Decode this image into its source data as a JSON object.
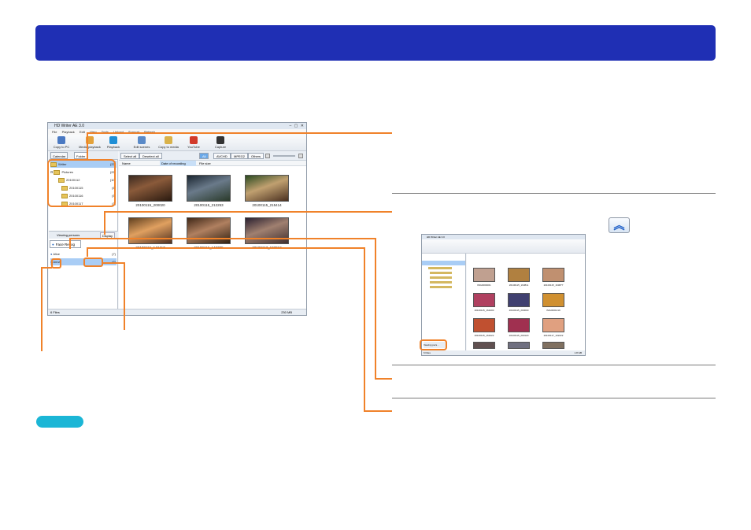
{
  "window": {
    "title": "HD Writer AE 3.0",
    "controls": "– ▢ ✕",
    "menu": [
      "File",
      "Playback",
      "Edit",
      "View",
      "Tools",
      "Upload",
      "Support",
      "Refresh"
    ],
    "toolbar": [
      "Copy to PC",
      "Media playback",
      "Playback",
      "Edit scenes",
      "Copy to media",
      "YouTube",
      "Capture"
    ],
    "tabs": {
      "calendar": "Calendar",
      "folder": "Folder"
    },
    "tree": [
      {
        "label": "Writer",
        "count": "(22)"
      },
      {
        "label": "Pictures",
        "count": "(22)"
      },
      {
        "label": "20100112",
        "count": "(10)"
      },
      {
        "label": "20100115",
        "count": "(6)"
      },
      {
        "label": "20100116",
        "count": "(5)"
      },
      {
        "label": "20100117",
        "count": "(1)"
      }
    ],
    "viewing_persons": "Viewing persons",
    "display": "Display",
    "face_recog": "Face Recog",
    "persons": [
      {
        "name": "Alice",
        "count": "(7)"
      },
      {
        "name": "Anna",
        "count": "(6)"
      }
    ],
    "select_all": "Select all",
    "deselect_all": "Deselect all",
    "filters": [
      "All",
      "AVCHD",
      "MPEG2",
      "Others"
    ],
    "columns": {
      "name": "Name",
      "date": "Date of recording",
      "size": "File size"
    },
    "thumbnails": [
      "20100115_200020",
      "20100115_212253",
      "20100115_215414",
      "20100116_143417",
      "20100116_143705",
      "20100117_103012"
    ],
    "status_left": "6 Files",
    "status_right": "230 MB"
  },
  "up_button": {
    "icon": "double-chevron-up-icon",
    "glyph": "︽"
  },
  "mini": {
    "title": "HD Writer AE 3.0",
    "thumbnails": [
      "IMG0000001",
      "20100115_163811",
      "20100115_163877",
      "20100115_164200",
      "20100115_200000",
      "IMG0001019",
      "20100115_164222",
      "20100115_200120",
      "20100117_102222",
      "IMG0000014",
      "20100115_205000",
      "20100115_215213"
    ],
    "viewing_persons": "Viewing pers...",
    "status_left": "6 Files",
    "status_right": "1.8 GB"
  },
  "colors": {
    "banner": "#1f2fb4",
    "callout": "#f0822a",
    "note_pill": "#1bb6d6"
  }
}
